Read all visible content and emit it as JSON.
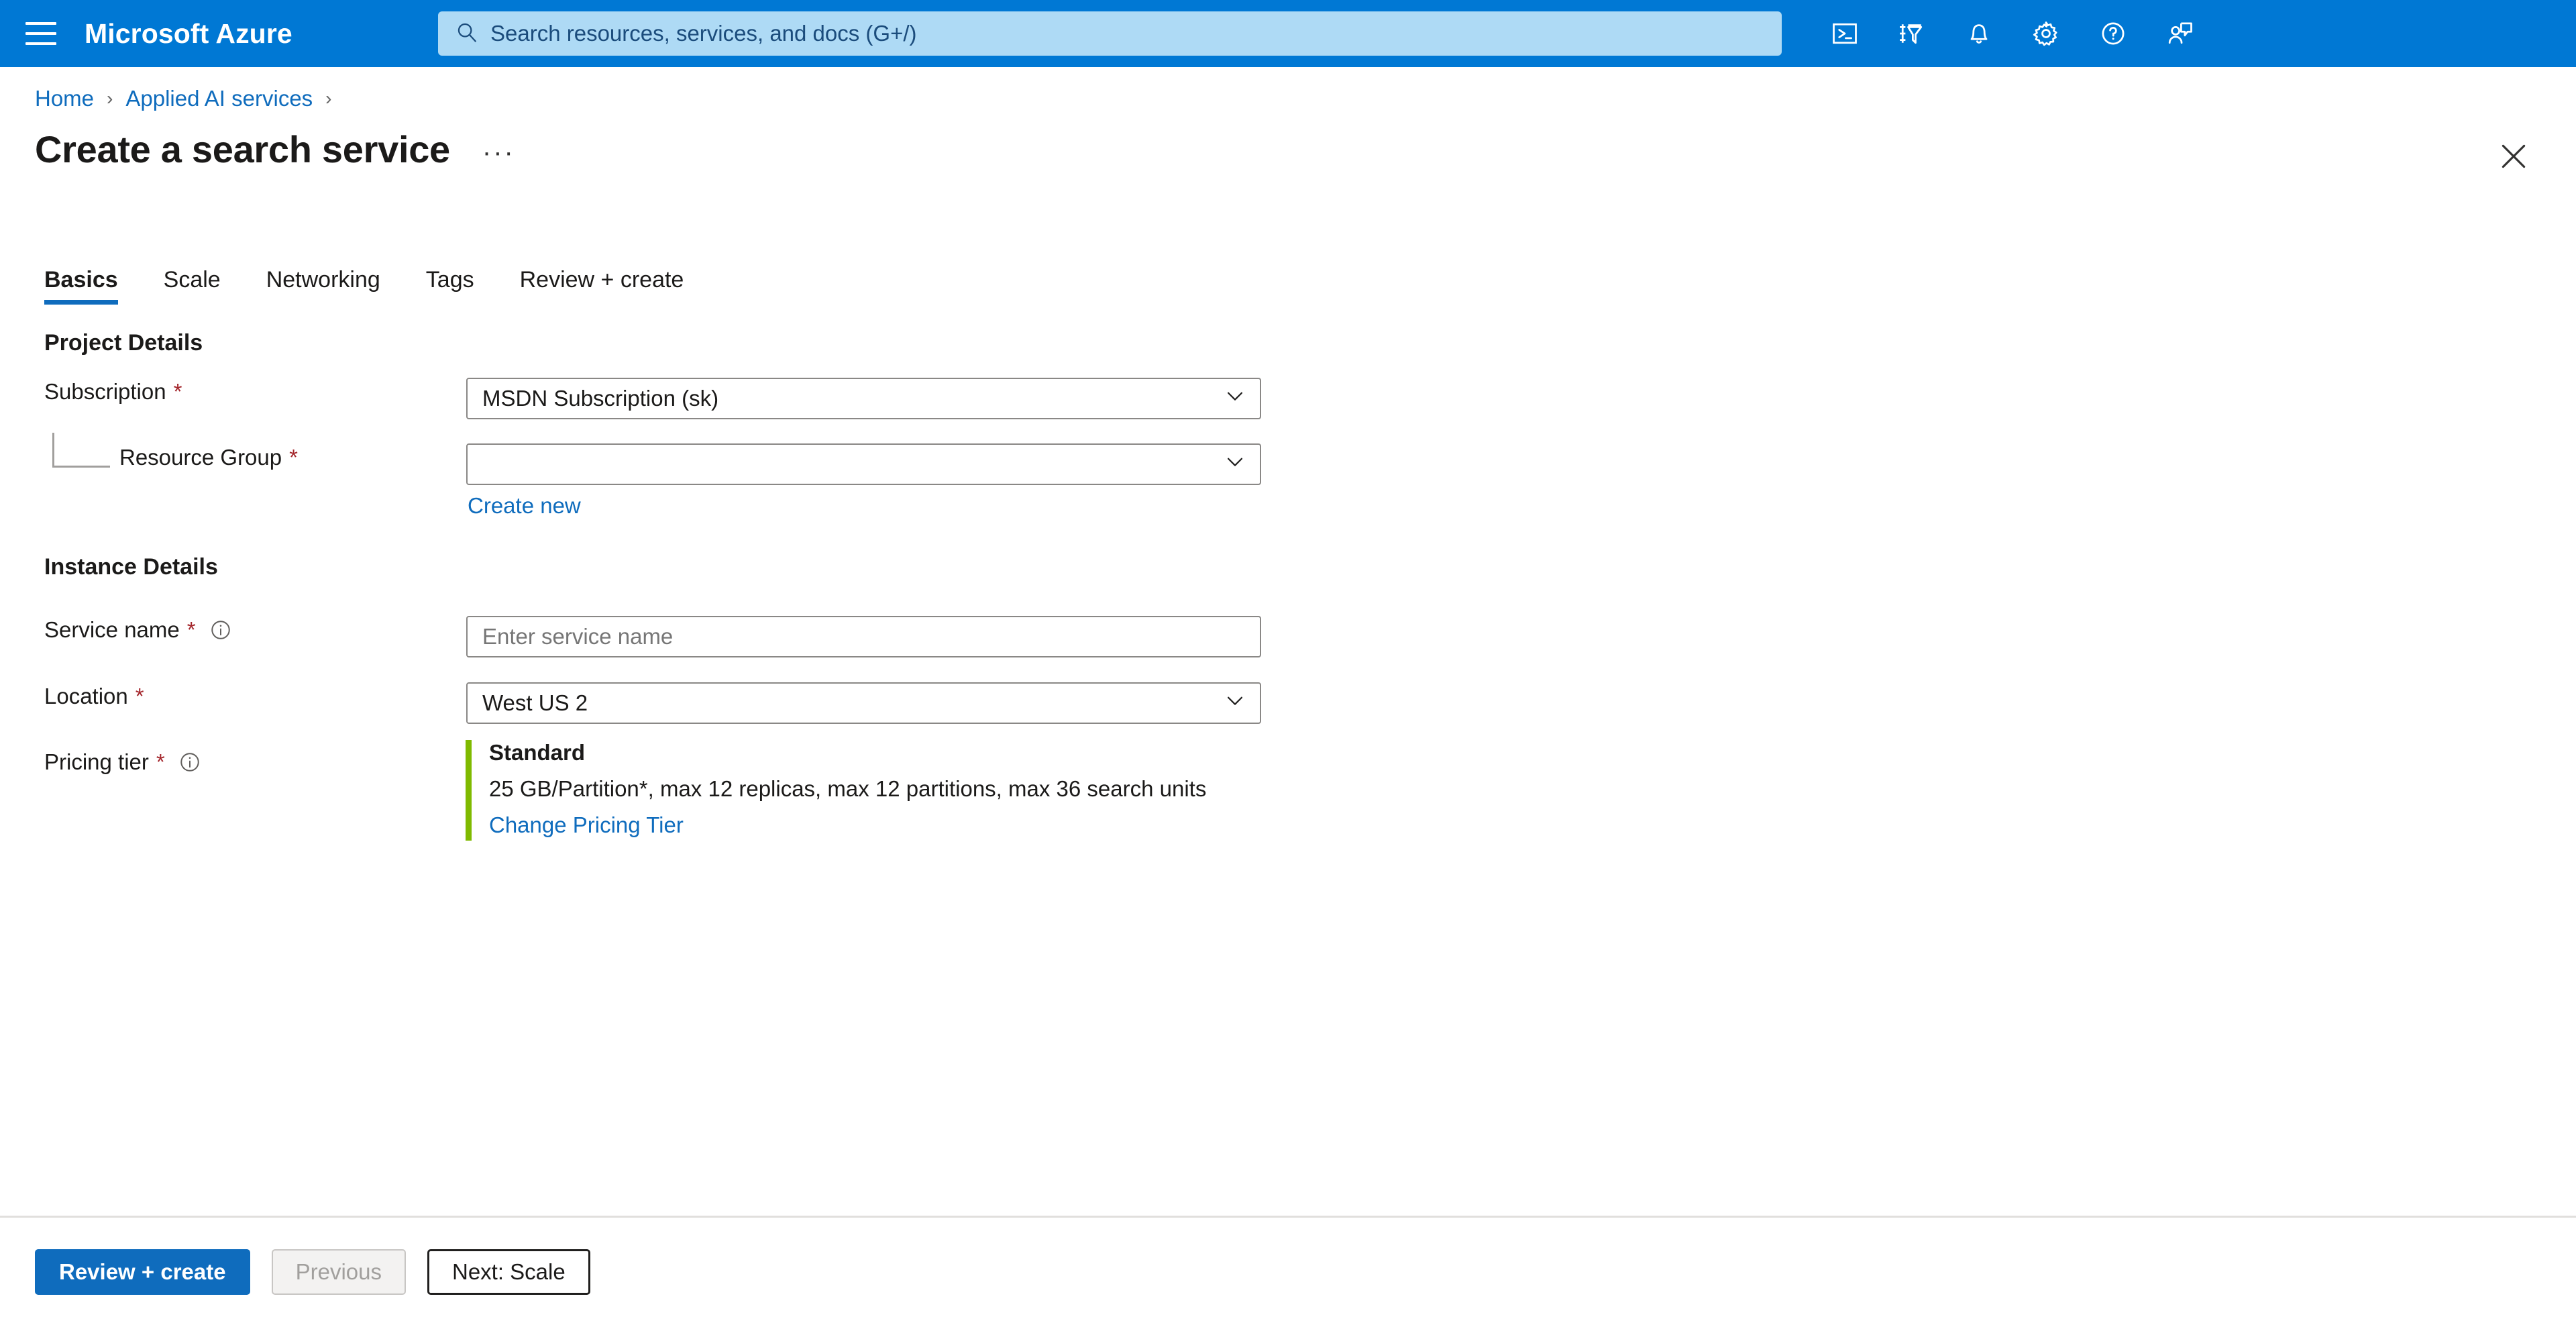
{
  "header": {
    "menu_icon": "hamburger-icon",
    "brand": "Microsoft Azure",
    "search": {
      "placeholder": "Search resources, services, and docs (G+/)",
      "icon": "search-icon"
    },
    "icons": [
      {
        "name": "cloud-shell-icon",
        "label": "Cloud Shell"
      },
      {
        "name": "directories-subscriptions-icon",
        "label": "Directories + subscriptions"
      },
      {
        "name": "notifications-bell-icon",
        "label": "Notifications"
      },
      {
        "name": "settings-gear-icon",
        "label": "Settings"
      },
      {
        "name": "help-question-icon",
        "label": "Help"
      },
      {
        "name": "feedback-icon",
        "label": "Feedback"
      }
    ],
    "accent_color": "#0078D4"
  },
  "breadcrumb": {
    "items": [
      {
        "label": "Home"
      },
      {
        "label": "Applied AI services"
      }
    ],
    "separator": "›"
  },
  "page": {
    "title": "Create a search service",
    "ellipsis": "···",
    "close_icon": "close-icon"
  },
  "tabs": [
    {
      "label": "Basics",
      "active": true
    },
    {
      "label": "Scale",
      "active": false
    },
    {
      "label": "Networking",
      "active": false
    },
    {
      "label": "Tags",
      "active": false
    },
    {
      "label": "Review + create",
      "active": false
    }
  ],
  "form": {
    "project_details": {
      "heading": "Project Details",
      "subscription": {
        "label": "Subscription",
        "required_marker": "*",
        "value": "MSDN Subscription (sk)"
      },
      "resource_group": {
        "label": "Resource Group",
        "required_marker": "*",
        "value": "",
        "create_new_link": "Create new"
      }
    },
    "instance_details": {
      "heading": "Instance Details",
      "service_name": {
        "label": "Service name",
        "required_marker": "*",
        "info_icon": "info-icon",
        "value": "",
        "placeholder": "Enter service name"
      },
      "location": {
        "label": "Location",
        "required_marker": "*",
        "value": "West US 2"
      },
      "pricing_tier": {
        "label": "Pricing tier",
        "required_marker": "*",
        "info_icon": "info-icon",
        "tier_name": "Standard",
        "tier_description": "25 GB/Partition*, max 12 replicas, max 12 partitions, max 36 search units",
        "change_link": "Change Pricing Tier",
        "accent_color": "#7FBA00"
      }
    }
  },
  "footer": {
    "review_create": "Review + create",
    "previous": "Previous",
    "next": "Next: Scale"
  }
}
